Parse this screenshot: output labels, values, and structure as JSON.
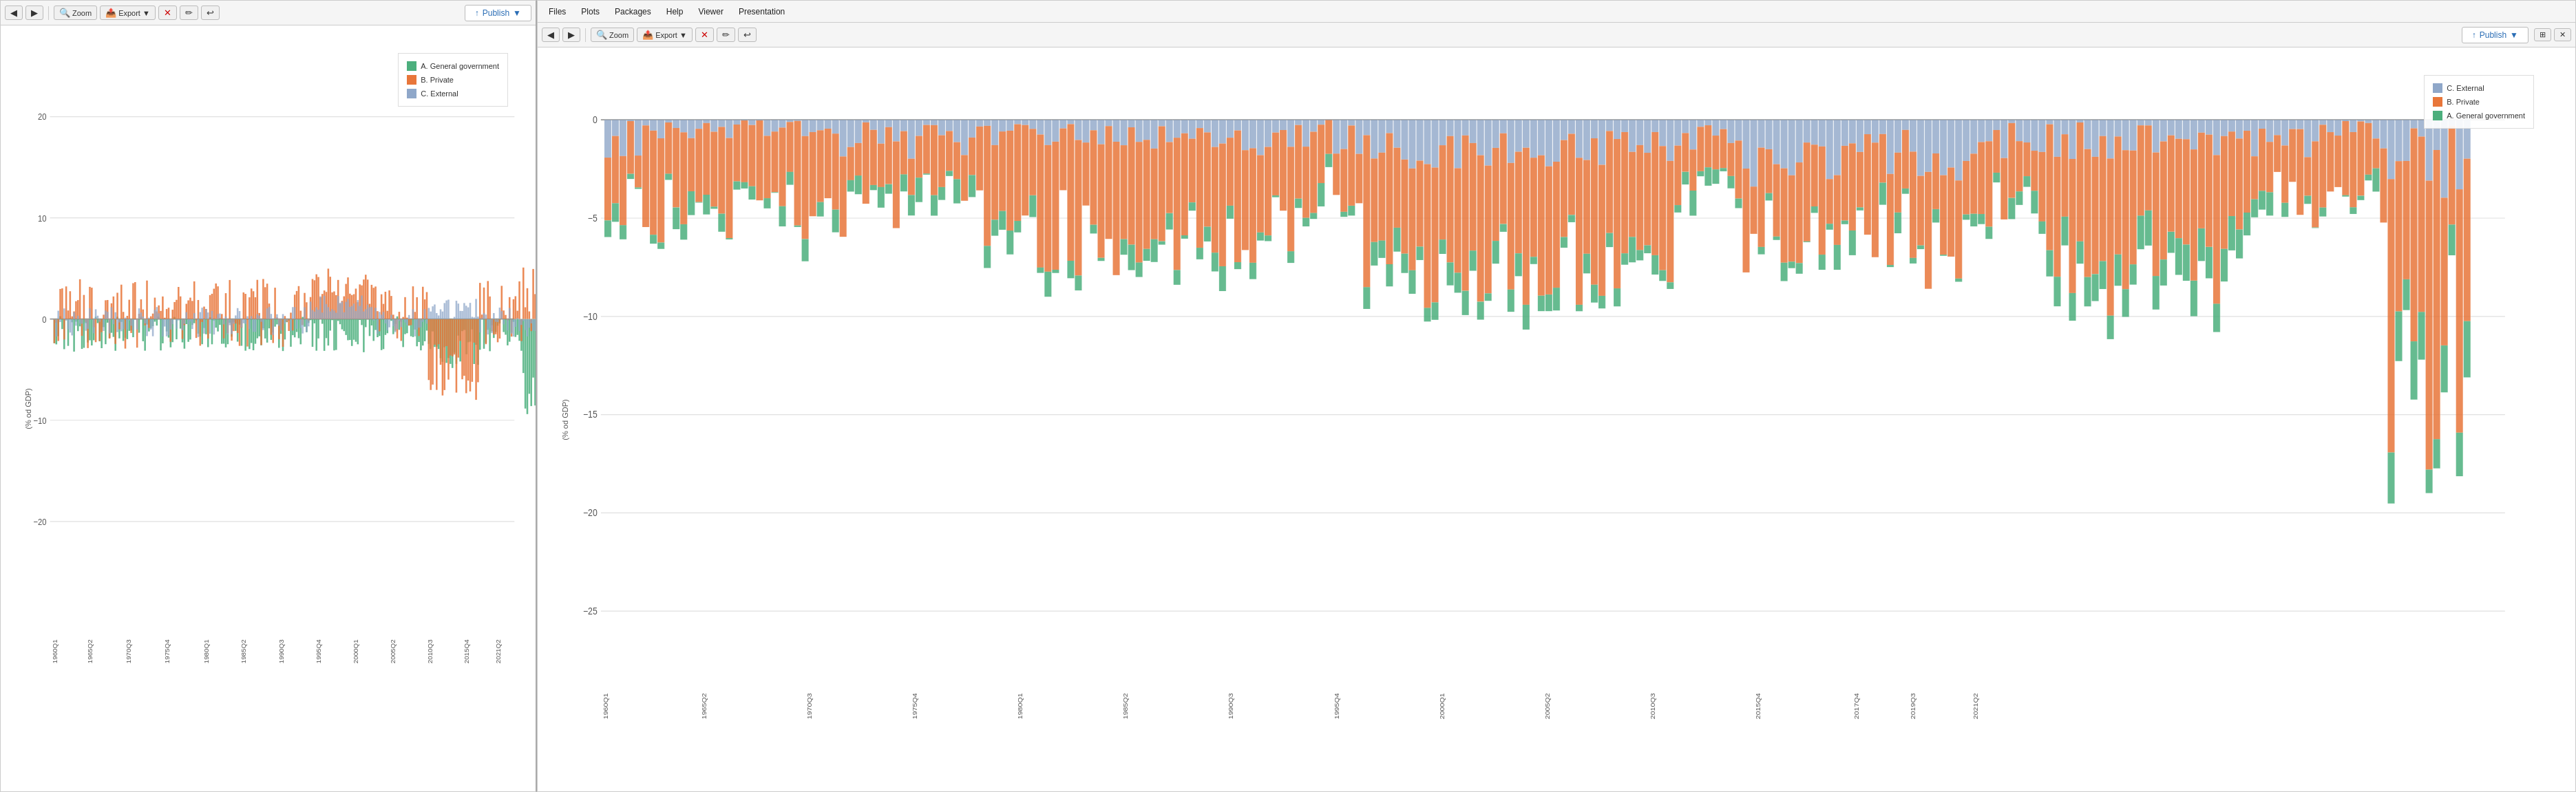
{
  "left_panel": {
    "toolbar": {
      "back_label": "◀",
      "forward_label": "▶",
      "zoom_label": "Zoom",
      "export_label": "Export",
      "export_arrow": "▼",
      "clear_icon": "✕",
      "brush_icon": "✏",
      "publish_label": "Publish",
      "publish_arrow": "▼",
      "publish_icon": "↑"
    },
    "chart": {
      "y_label": "(% od GDP)",
      "y_ticks": [
        "20",
        "10",
        "0",
        "−10",
        "−20"
      ],
      "legend": [
        {
          "label": "A. General government",
          "color": "#4CAF7D"
        },
        {
          "label": "B. Private",
          "color": "#E8763A"
        },
        {
          "label": "C. External",
          "color": "#8FA7C9"
        }
      ]
    }
  },
  "right_panel": {
    "menubar": {
      "items": [
        "Files",
        "Plots",
        "Packages",
        "Help",
        "Viewer",
        "Presentation"
      ]
    },
    "toolbar": {
      "back_label": "◀",
      "forward_label": "▶",
      "zoom_label": "Zoom",
      "export_label": "Export",
      "export_arrow": "▼",
      "clear_icon": "✕",
      "brush_icon": "✏",
      "undo_icon": "↩",
      "publish_label": "Publish",
      "publish_arrow": "▼",
      "publish_icon": "↑"
    },
    "chart": {
      "y_label": "(% od GDP)",
      "y_ticks": [
        "0",
        "−5",
        "−10",
        "−15",
        "−20",
        "−25"
      ],
      "legend": [
        {
          "label": "C. External",
          "color": "#8FA7C9"
        },
        {
          "label": "B. Private",
          "color": "#E8763A"
        },
        {
          "label": "A. General government",
          "color": "#4CAF7D"
        }
      ]
    }
  }
}
